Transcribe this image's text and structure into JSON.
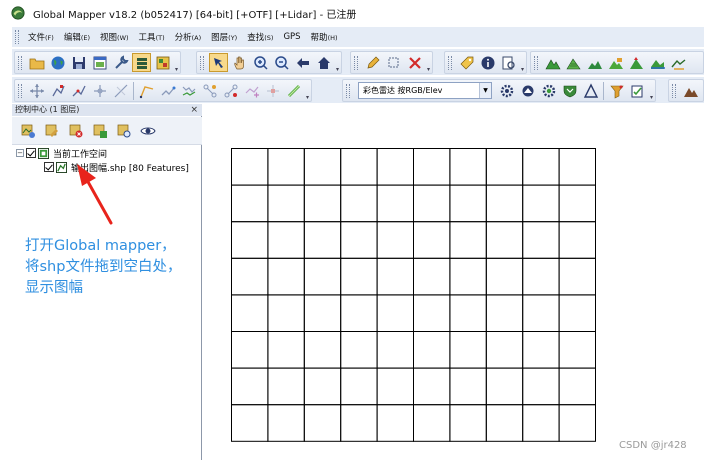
{
  "window": {
    "title": "Global Mapper v18.2 (b052417) [64-bit] [+OTF] [+Lidar] - 已注册"
  },
  "menu": [
    {
      "label": "文件",
      "acc": "(F)"
    },
    {
      "label": "编辑",
      "acc": "(E)"
    },
    {
      "label": "视图",
      "acc": "(W)"
    },
    {
      "label": "工具",
      "acc": "(T)"
    },
    {
      "label": "分析",
      "acc": "(A)"
    },
    {
      "label": "图层",
      "acc": "(Y)"
    },
    {
      "label": "查找",
      "acc": "(S)"
    },
    {
      "label": "GPS",
      "acc": ""
    },
    {
      "label": "帮助",
      "acc": "(H)"
    }
  ],
  "toolbar": {
    "row1_tools": [
      "open-folder",
      "globe",
      "save",
      "window",
      "wrench",
      "layers-active",
      "color-picker",
      "digitize-active",
      "pan-hand",
      "zoom-in",
      "zoom-out",
      "back-arrow",
      "home",
      "pencil",
      "select-box",
      "delete-x",
      "measure-tag",
      "info",
      "feature-search",
      "terrain-1",
      "terrain-2",
      "terrain-3",
      "terrain-4",
      "terrain-5",
      "terrain-6"
    ],
    "row2_tools": [
      "move-vertex",
      "edit-vertex",
      "edit-line",
      "snap",
      "draw-line",
      "route",
      "path-profile",
      "path-2",
      "path-3",
      "ruler-line",
      "line-tool",
      "gear",
      "settings-2",
      "settings-3",
      "shield",
      "triangle",
      "funnel",
      "check-edit",
      "mountain"
    ],
    "shader_dropdown": "彩色雷达 按RGB/Elev"
  },
  "control_center": {
    "title": "控制中心 (1 图层)",
    "close": "×",
    "tools": [
      "layer-new",
      "layer-edit",
      "layer-delete",
      "layer-props",
      "layer-zoom",
      "layer-view"
    ],
    "tree": {
      "workspace": {
        "label": "当前工作空间",
        "checked": true,
        "expanded": true
      },
      "layers": [
        {
          "label": "输出图幅.shp [80 Features]",
          "checked": true
        }
      ]
    }
  },
  "annotation": {
    "lines": [
      "打开Global mapper，",
      "将shp文件拖到空白处，",
      "显示图幅"
    ],
    "color": "#2f8fe0"
  },
  "map": {
    "grid_rows": 8,
    "grid_cols": 10,
    "line_color": "#000000"
  },
  "watermark": "CSDN @jr428"
}
